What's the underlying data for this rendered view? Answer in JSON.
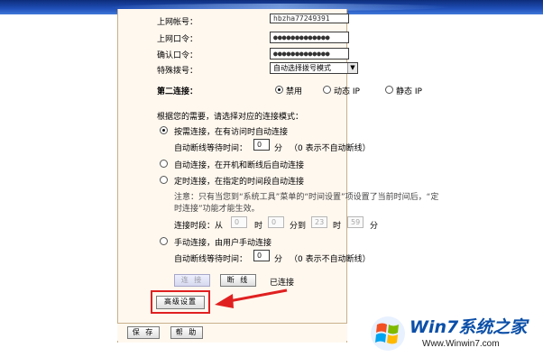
{
  "form": {
    "account_label": "上网帐号：",
    "account_value": "hbzha77249391",
    "password_label": "上网口令：",
    "password_value": "●●●●●●●●●●●●●",
    "confirm_label": "确认口令：",
    "confirm_value": "●●●●●●●●●●●●●",
    "dial_label": "特殊拨号：",
    "dial_value": "自动选择拨号模式",
    "second_conn_label": "第二连接：",
    "second_conn_options": [
      "禁用",
      "动态 IP",
      "静态 IP"
    ],
    "second_conn_selected": "禁用"
  },
  "mode_intro": "根据您的需要，请选择对应的连接模式：",
  "modes": {
    "on_demand": "按需连接，在有访问时自动连接",
    "idle_label": "自动断线等待时间：",
    "idle_value": "0",
    "idle_unit": "分",
    "idle_note": "（0 表示不自动断线）",
    "auto": "自动连接，在开机和断线后自动连接",
    "scheduled": "定时连接，在指定的时间段自动连接",
    "notice_line1": "注意：只有当您到“系统工具”菜单的“时间设置”项设置了当前时间后，“定",
    "notice_line2": "时连接”功能才能生效。",
    "time_label": "连接时段：从",
    "time_from_hour": "0",
    "time_hour_unit": "时",
    "time_from_min": "0",
    "time_to_label": "分到",
    "time_to_hour": "23",
    "time_to_hour_unit": "时",
    "time_to_min": "59",
    "time_to_min_unit": "分",
    "manual": "手动连接，由用户手动连接",
    "manual_idle_label": "自动断线等待时间：",
    "manual_idle_value": "0",
    "manual_idle_unit": "分",
    "manual_idle_note": "（0 表示不自动断线）",
    "selected": "on_demand"
  },
  "actions": {
    "connect_label": "连 接",
    "disconnect_label": "断 线",
    "status_text": "已连接",
    "advanced_label": "高级设置",
    "save_label": "保 存",
    "help_label": "帮 助"
  },
  "watermark": {
    "brand": "Win7系统之家",
    "url": "Www.Winwin7.com"
  },
  "colors": {
    "content_bg": "#fff8ef",
    "highlight": "#e02020",
    "accent_blue": "#1f4fb8"
  }
}
